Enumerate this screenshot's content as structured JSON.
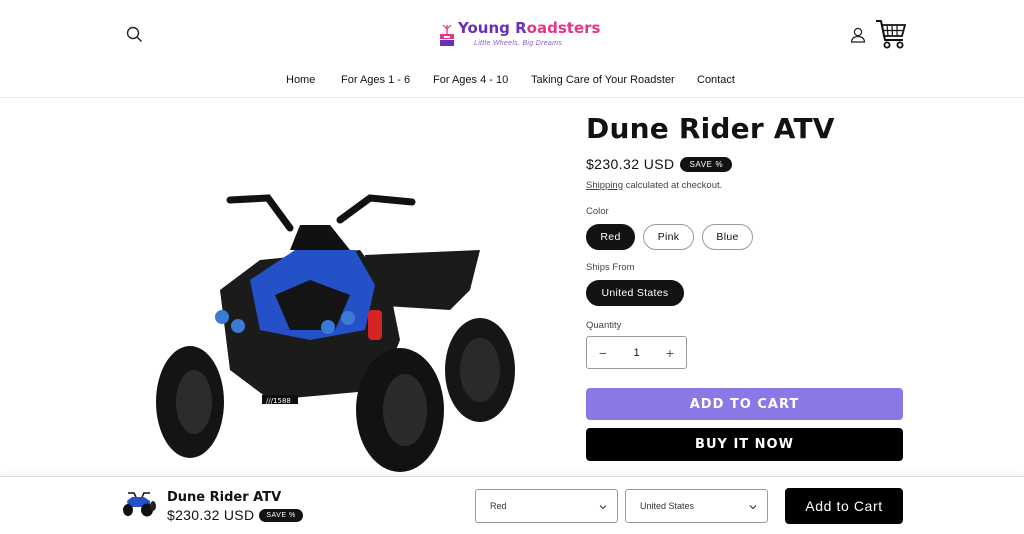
{
  "header": {
    "logo_title_part1": "Young R",
    "logo_title_part2": "oadsters",
    "logo_tagline": "Little Wheels, Big Dreams",
    "nav": [
      {
        "label": "Home"
      },
      {
        "label": "For Ages 1 - 6"
      },
      {
        "label": "For Ages 4 - 10"
      },
      {
        "label": "Taking Care of Your Roadster"
      },
      {
        "label": "Contact"
      }
    ]
  },
  "product": {
    "title": "Dune Rider ATV",
    "price": "$230.32 USD",
    "badge": "SAVE %",
    "shipping_link": "Shipping",
    "shipping_text": " calculated at checkout.",
    "color_label": "Color",
    "colors": [
      {
        "label": "Red",
        "selected": true
      },
      {
        "label": "Pink",
        "selected": false
      },
      {
        "label": "Blue",
        "selected": false
      }
    ],
    "ships_from_label": "Ships From",
    "ships_from": [
      {
        "label": "United States",
        "selected": true
      }
    ],
    "quantity_label": "Quantity",
    "quantity": "1",
    "qty_minus": "−",
    "qty_plus": "+",
    "add_to_cart": "ADD TO CART",
    "buy_now": "BUY IT NOW"
  },
  "sticky": {
    "title": "Dune Rider ATV",
    "price": "$230.32 USD",
    "badge": "SAVE %",
    "color_select": "Red",
    "ships_select": "United States",
    "add_to_cart": "Add to Cart"
  },
  "colors": {
    "accent_purple": "#8b77e6",
    "logo_purple": "#6a2fb8",
    "logo_pink": "#e8338a",
    "atv_blue": "#2450c8"
  },
  "icons": [
    "search-icon",
    "account-icon",
    "cart-icon",
    "logo-icon",
    "chevron-down-icon"
  ]
}
